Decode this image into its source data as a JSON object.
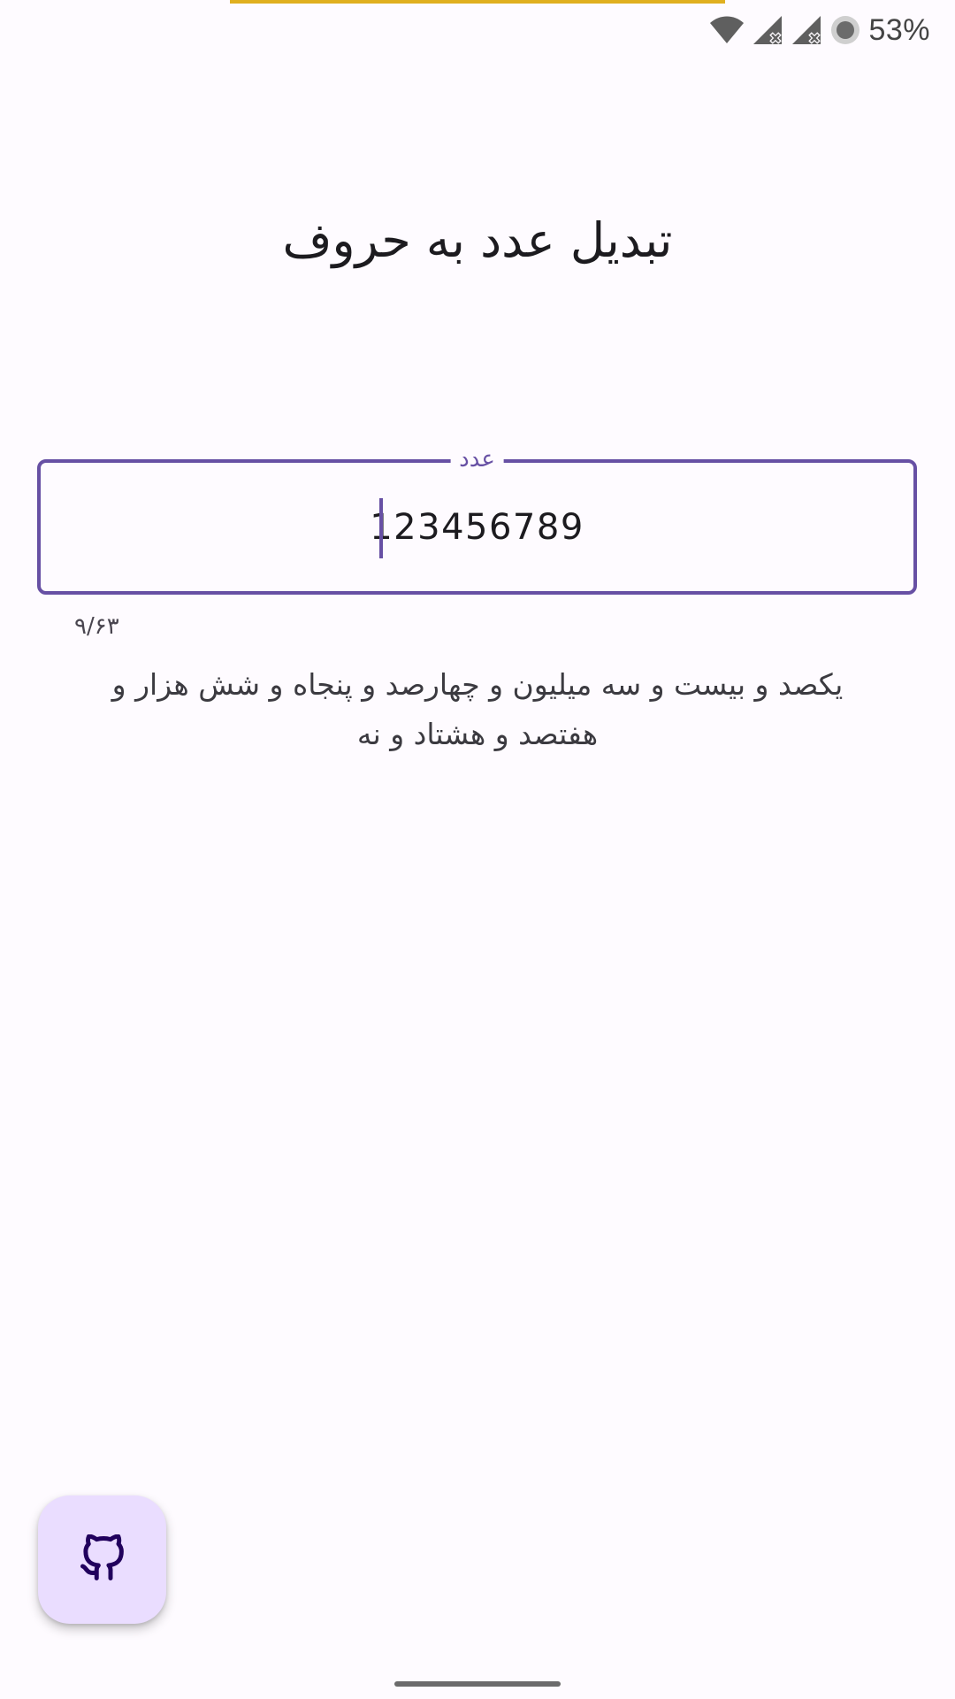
{
  "status_bar": {
    "battery_percent": "53%",
    "icons": [
      "wifi-icon",
      "signal-no-service-icon",
      "signal-no-service-icon",
      "battery-saver-icon"
    ]
  },
  "page": {
    "title": "تبدیل عدد به حروف"
  },
  "number_field": {
    "label": "عدد",
    "value": "123456789",
    "counter": "۹/۶۳"
  },
  "result": {
    "text": "یکصد و بیست و سه میلیون  و چهارصد و پنجاه و شش هزار  و هفتصد و هشتاد و نه"
  },
  "fab": {
    "icon": "github-icon"
  },
  "colors": {
    "accent": "#6750a4",
    "fab_background": "#eaddff",
    "background": "#fefbff",
    "top_indicator": "#e0b020"
  }
}
